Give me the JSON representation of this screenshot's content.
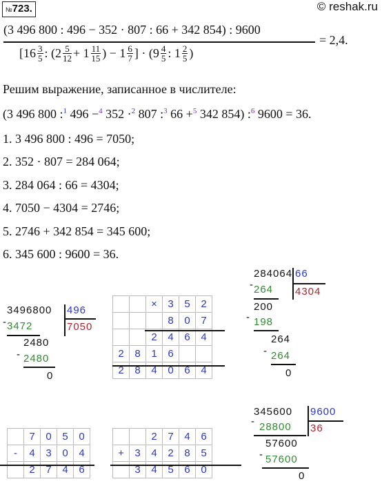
{
  "header": {
    "problem_prefix": "№",
    "problem_number": "723.",
    "watermark": "© reshak.ru"
  },
  "expression": {
    "numerator": "(3 496 800 : 496 − 352 · 807 : 66 + 342 854) : 9600",
    "den_open": "[16",
    "f1_n": "3",
    "f1_d": "5",
    "den_mid1": ": (2",
    "f2_n": "5",
    "f2_d": "12",
    "den_mid2": "+ 1",
    "f3_n": "11",
    "f3_d": "15",
    "den_mid3": ") − 1",
    "f4_n": "6",
    "f4_d": "7",
    "den_mid4": "] · (9",
    "f5_n": "4",
    "f5_d": "5",
    "den_mid5": ": 1",
    "f6_n": "2",
    "f6_d": "5",
    "den_close": ")",
    "result": "= 2,4."
  },
  "intro": "Решим выражение, записанное в числителе:",
  "order_line": {
    "p1": "(3 496 800 :",
    "o1": "1",
    "p2": " 496 −",
    "o2": "4",
    "p3": " 352 ·",
    "o3": "2",
    "p4": " 807 :",
    "o4": "3",
    "p5": " 66 +",
    "o5": "5",
    "p6": " 342 854) :",
    "o6": "6",
    "p7": " 9600 = 36."
  },
  "steps": [
    "1.  3 496 800 : 496 = 7050;",
    "2.  352 · 807 = 284 064;",
    "3.  284 064 : 66 = 4304;",
    "4.  7050 − 4304 = 2746;",
    "5.  2746 + 342 854 = 345 600;",
    "6.  345 600 : 9600 = 36."
  ],
  "div1": {
    "dividend": "3496800",
    "divisor": "496",
    "quotient": "7050",
    "sub1": "3472",
    "rem1": "2480",
    "sub2": "2480",
    "rem2": "0"
  },
  "mult": {
    "sign": "×",
    "a": [
      "3",
      "5",
      "2"
    ],
    "b": [
      "8",
      "0",
      "7"
    ],
    "p1": [
      "2",
      "4",
      "6",
      "4"
    ],
    "p2": [
      "2",
      "8",
      "1",
      "6"
    ],
    "res": [
      "2",
      "8",
      "4",
      "0",
      "6",
      "4"
    ]
  },
  "div2": {
    "dividend": "284064",
    "divisor": "66",
    "quotient": "4304",
    "sub1": "264",
    "rem1": "200",
    "sub2": "198",
    "rem2": "264",
    "sub3": "264",
    "rem3": "0"
  },
  "subtr": {
    "sign": "-",
    "a": [
      "7",
      "0",
      "5",
      "0"
    ],
    "b": [
      "4",
      "3",
      "0",
      "4"
    ],
    "res": [
      "2",
      "7",
      "4",
      "6"
    ]
  },
  "addit": {
    "sign": "+",
    "a": [
      "2",
      "7",
      "4",
      "6"
    ],
    "b": [
      "3",
      "4",
      "2",
      "8",
      "5",
      "4"
    ],
    "res": [
      "3",
      "4",
      "5",
      "6",
      "0",
      "0"
    ]
  },
  "div3": {
    "dividend": "345600",
    "divisor": "9600",
    "quotient": "36",
    "sub1": "28800",
    "rem1": "57600",
    "sub2": "57600",
    "rem2": "0"
  }
}
